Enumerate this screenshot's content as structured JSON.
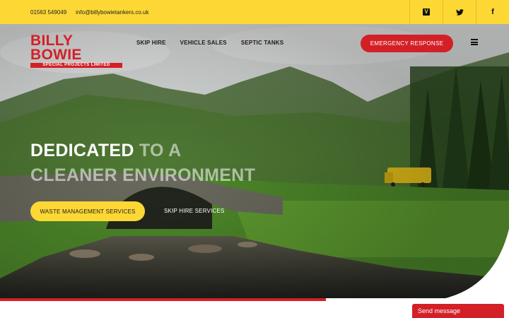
{
  "topbar": {
    "phone": "01563 549049",
    "email": "info@billybowietankers.co.uk",
    "social": [
      {
        "icon": "vimeo-icon",
        "glyph": "V"
      },
      {
        "icon": "twitter-icon",
        "glyph": "🐦"
      },
      {
        "icon": "facebook-icon",
        "glyph": "f"
      }
    ]
  },
  "header": {
    "logo_main": "BILLY BOWIE",
    "logo_sub": "SPECIAL PROJECTS LIMITED",
    "nav": [
      "SKIP HIRE",
      "VEHICLE SALES",
      "SEPTIC TANKS"
    ],
    "emergency": "EMERGENCY RESPONSE",
    "menu_icon": "hamburger-icon"
  },
  "hero": {
    "headline_line1_bold": "DEDICATED",
    "headline_line1_faded": " TO A",
    "headline_line2": "CLEANER ENVIRONMENT",
    "primary_button": "WASTE MANAGEMENT SERVICES",
    "secondary_link": "SKIP HIRE SERVICES"
  },
  "chat": {
    "label": "Send message"
  },
  "colors": {
    "brand_yellow": "#fdd835",
    "brand_red": "#d32027"
  }
}
